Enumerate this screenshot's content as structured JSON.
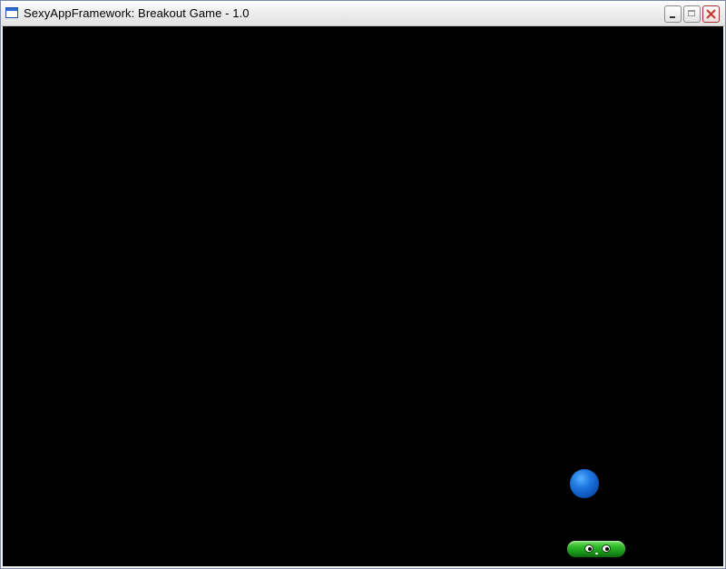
{
  "window": {
    "title": "SexyAppFramework: Breakout Game - 1.0",
    "icon": "app-window-icon",
    "buttons": {
      "minimize_icon": "minimize-icon",
      "maximize_icon": "maximize-icon",
      "close_icon": "close-icon"
    }
  },
  "game": {
    "background_color": "#000000",
    "ball": {
      "color": "#1e78e0"
    },
    "paddle": {
      "color": "#2fbb2a"
    }
  }
}
